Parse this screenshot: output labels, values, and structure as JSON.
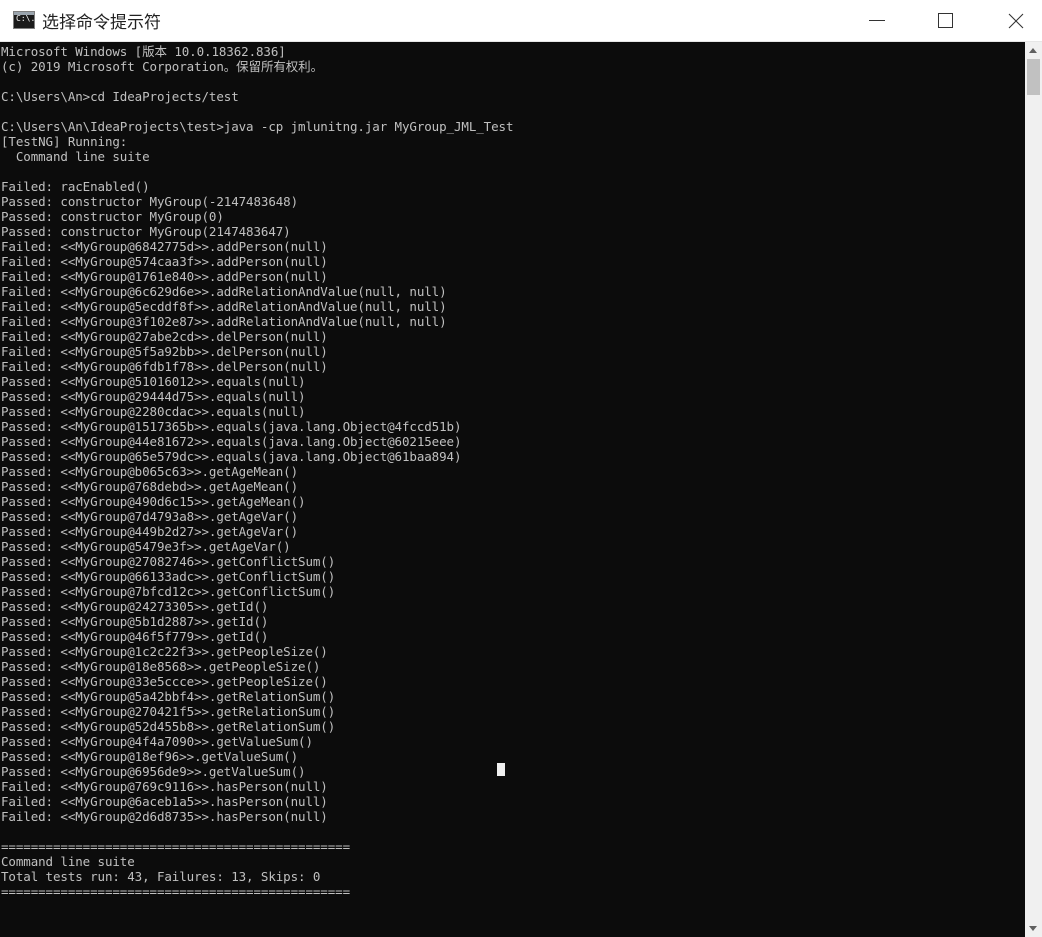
{
  "window": {
    "title": "选择命令提示符",
    "icon_label": "C:\\.",
    "minimize_icon": "minimize-icon",
    "maximize_icon": "maximize-icon",
    "close_icon": "close-icon"
  },
  "console": {
    "text_color": "#c0c0c0",
    "background": "#0c0c0c",
    "lines": [
      "Microsoft Windows [版本 10.0.18362.836]",
      "(c) 2019 Microsoft Corporation。保留所有权利。",
      "",
      "C:\\Users\\An>cd IdeaProjects/test",
      "",
      "C:\\Users\\An\\IdeaProjects\\test>java -cp jmlunitng.jar MyGroup_JML_Test",
      "[TestNG] Running:",
      "  Command line suite",
      "",
      "Failed: racEnabled()",
      "Passed: constructor MyGroup(-2147483648)",
      "Passed: constructor MyGroup(0)",
      "Passed: constructor MyGroup(2147483647)",
      "Failed: <<MyGroup@6842775d>>.addPerson(null)",
      "Failed: <<MyGroup@574caa3f>>.addPerson(null)",
      "Failed: <<MyGroup@1761e840>>.addPerson(null)",
      "Failed: <<MyGroup@6c629d6e>>.addRelationAndValue(null, null)",
      "Failed: <<MyGroup@5ecddf8f>>.addRelationAndValue(null, null)",
      "Failed: <<MyGroup@3f102e87>>.addRelationAndValue(null, null)",
      "Failed: <<MyGroup@27abe2cd>>.delPerson(null)",
      "Failed: <<MyGroup@5f5a92bb>>.delPerson(null)",
      "Failed: <<MyGroup@6fdb1f78>>.delPerson(null)",
      "Passed: <<MyGroup@51016012>>.equals(null)",
      "Passed: <<MyGroup@29444d75>>.equals(null)",
      "Passed: <<MyGroup@2280cdac>>.equals(null)",
      "Passed: <<MyGroup@1517365b>>.equals(java.lang.Object@4fccd51b)",
      "Passed: <<MyGroup@44e81672>>.equals(java.lang.Object@60215eee)",
      "Passed: <<MyGroup@65e579dc>>.equals(java.lang.Object@61baa894)",
      "Passed: <<MyGroup@b065c63>>.getAgeMean()",
      "Passed: <<MyGroup@768debd>>.getAgeMean()",
      "Passed: <<MyGroup@490d6c15>>.getAgeMean()",
      "Passed: <<MyGroup@7d4793a8>>.getAgeVar()",
      "Passed: <<MyGroup@449b2d27>>.getAgeVar()",
      "Passed: <<MyGroup@5479e3f>>.getAgeVar()",
      "Passed: <<MyGroup@27082746>>.getConflictSum()",
      "Passed: <<MyGroup@66133adc>>.getConflictSum()",
      "Passed: <<MyGroup@7bfcd12c>>.getConflictSum()",
      "Passed: <<MyGroup@24273305>>.getId()",
      "Passed: <<MyGroup@5b1d2887>>.getId()",
      "Passed: <<MyGroup@46f5f779>>.getId()",
      "Passed: <<MyGroup@1c2c22f3>>.getPeopleSize()",
      "Passed: <<MyGroup@18e8568>>.getPeopleSize()",
      "Passed: <<MyGroup@33e5ccce>>.getPeopleSize()",
      "Passed: <<MyGroup@5a42bbf4>>.getRelationSum()",
      "Passed: <<MyGroup@270421f5>>.getRelationSum()",
      "Passed: <<MyGroup@52d455b8>>.getRelationSum()",
      "Passed: <<MyGroup@4f4a7090>>.getValueSum()",
      "Passed: <<MyGroup@18ef96>>.getValueSum()",
      "Passed: <<MyGroup@6956de9>>.getValueSum()",
      "Failed: <<MyGroup@769c9116>>.hasPerson(null)",
      "Failed: <<MyGroup@6aceb1a5>>.hasPerson(null)",
      "Failed: <<MyGroup@2d6d8735>>.hasPerson(null)",
      "",
      "===============================================",
      "Command line suite",
      "Total tests run: 43, Failures: 13, Skips: 0",
      "==============================================="
    ]
  }
}
